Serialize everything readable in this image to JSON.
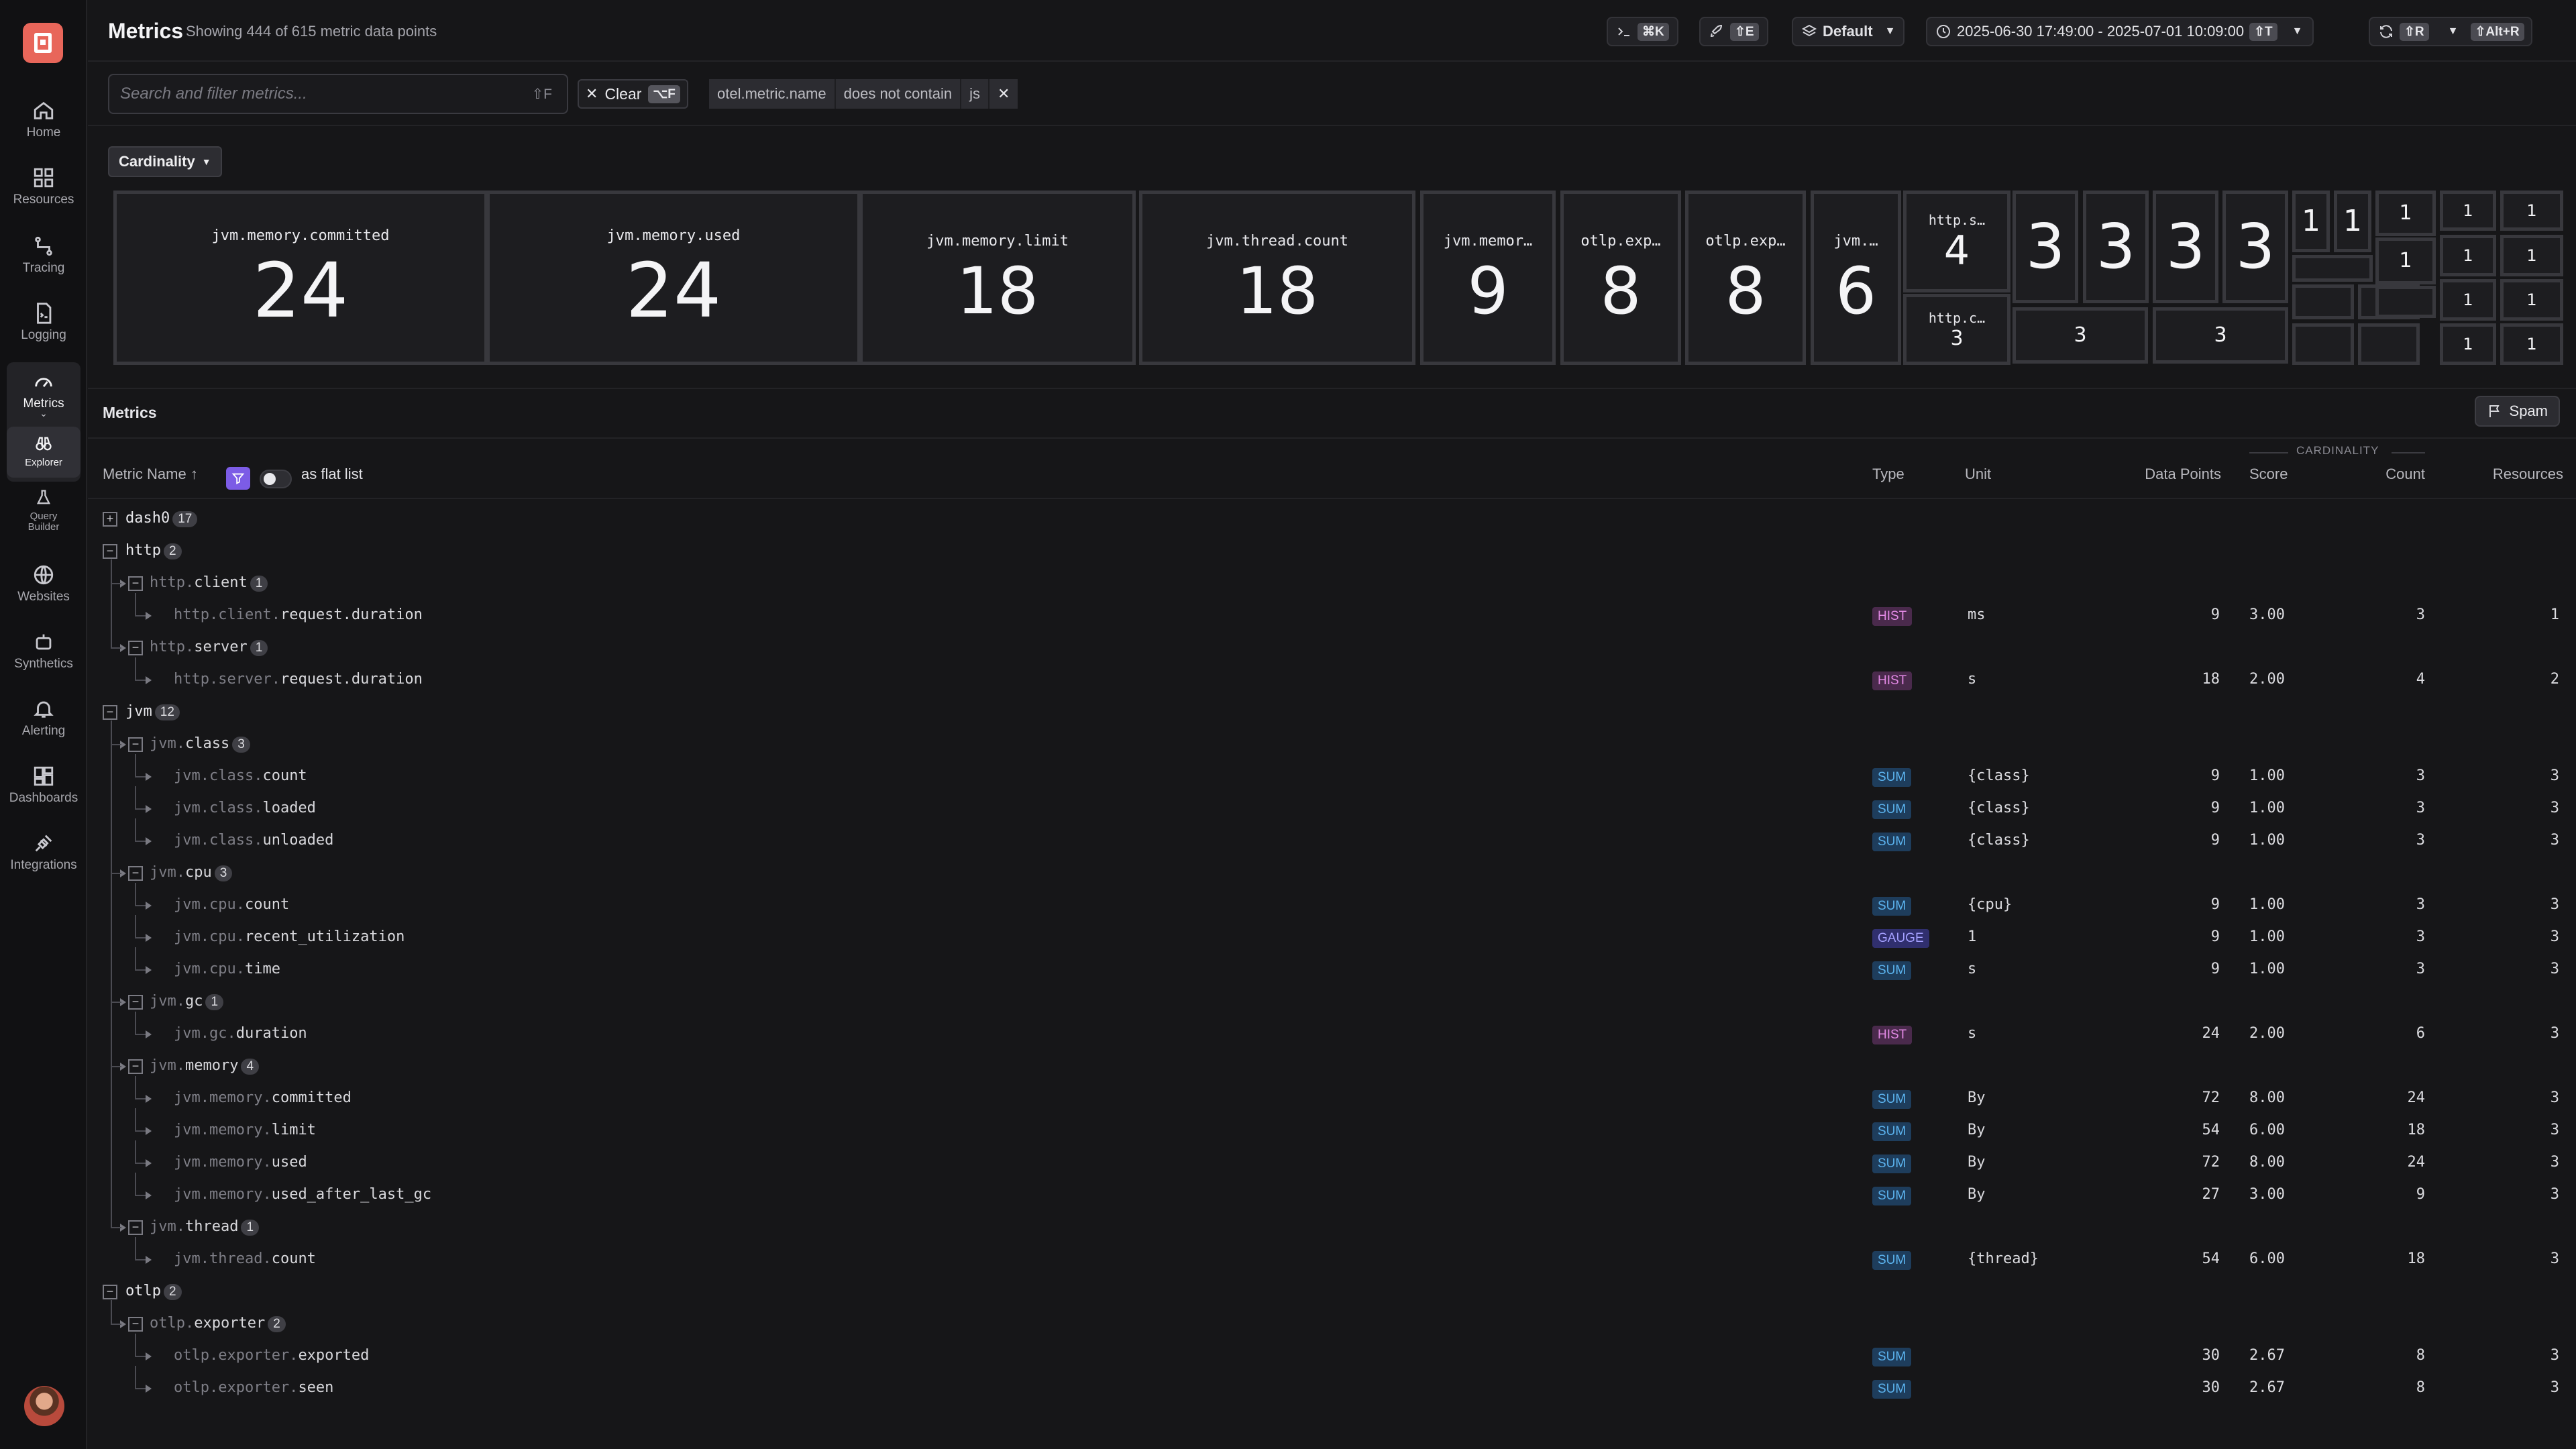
{
  "header": {
    "title": "Metrics",
    "subtitle": "Showing 444 of 615 metric data points",
    "command_kbd": "⌘K",
    "rocket_kbd": "⇧E",
    "dataset_label": "Default",
    "time_range": "2025-06-30 17:49:00 - 2025-07-01 10:09:00",
    "time_kbd": "⇧T",
    "refresh_kbd": "⇧R",
    "auto_kbd": "⇧Alt+R"
  },
  "sidebar": {
    "items": [
      {
        "label": "Home",
        "icon": "home-icon"
      },
      {
        "label": "Resources",
        "icon": "resources-icon"
      },
      {
        "label": "Tracing",
        "icon": "tracing-icon"
      },
      {
        "label": "Logging",
        "icon": "logging-icon"
      },
      {
        "label": "Metrics",
        "icon": "gauge-icon"
      },
      {
        "label": "Explorer",
        "icon": "binoculars-icon"
      },
      {
        "label": "Query Builder",
        "icon": "flask-icon"
      },
      {
        "label": "Websites",
        "icon": "globe-icon"
      },
      {
        "label": "Synthetics",
        "icon": "robot-icon"
      },
      {
        "label": "Alerting",
        "icon": "bell-icon"
      },
      {
        "label": "Dashboards",
        "icon": "dashboard-icon"
      },
      {
        "label": "Integrations",
        "icon": "plug-icon"
      }
    ]
  },
  "filter": {
    "search_placeholder": "Search and filter metrics...",
    "search_hint": "⇧F",
    "clear_label": "Clear",
    "clear_kbd": "⌥F",
    "chip_key": "otel.metric.name",
    "chip_op": "does not contain",
    "chip_value": "js"
  },
  "cardinality": {
    "dropdown_label": "Cardinality",
    "tiles": [
      {
        "name": "jvm.memory.committed",
        "value": "24"
      },
      {
        "name": "jvm.memory.used",
        "value": "24"
      },
      {
        "name": "jvm.memory.limit",
        "value": "18"
      },
      {
        "name": "jvm.thread.count",
        "value": "18"
      },
      {
        "name": "jvm.memor…",
        "value": "9"
      },
      {
        "name": "otlp.exp…",
        "value": "8"
      },
      {
        "name": "otlp.exp…",
        "value": "8"
      },
      {
        "name": "jvm.…",
        "value": "6"
      },
      {
        "name": "http.s…",
        "value": "4"
      },
      {
        "name": "http.c…",
        "value": "3"
      },
      {
        "name": "",
        "value": "3"
      },
      {
        "name": "",
        "value": "3"
      },
      {
        "name": "",
        "value": "3"
      },
      {
        "name": "",
        "value": "3"
      },
      {
        "name": "",
        "value": "3"
      },
      {
        "name": "",
        "value": "3"
      },
      {
        "name": "",
        "value": "1"
      },
      {
        "name": "",
        "value": "1"
      },
      {
        "name": "",
        "value": "1"
      },
      {
        "name": "",
        "value": "1"
      },
      {
        "name": "",
        "value": "1"
      },
      {
        "name": "",
        "value": "1"
      },
      {
        "name": "",
        "value": "1"
      },
      {
        "name": "",
        "value": "1"
      },
      {
        "name": "",
        "value": "1"
      },
      {
        "name": "",
        "value": "1"
      },
      {
        "name": "",
        "value": "1"
      },
      {
        "name": "",
        "value": "1"
      },
      {
        "name": "",
        "value": "1"
      },
      {
        "name": "",
        "value": ""
      },
      {
        "name": "",
        "value": ""
      },
      {
        "name": "",
        "value": ""
      },
      {
        "name": "",
        "value": ""
      },
      {
        "name": "",
        "value": ""
      }
    ]
  },
  "metrics": {
    "section_title": "Metrics",
    "spam_label": "Spam",
    "flat_list_label": "as flat list",
    "cardinality_group": "CARDINALITY",
    "columns": {
      "name": "Metric Name",
      "type": "Type",
      "unit": "Unit",
      "data_points": "Data Points",
      "score": "Score",
      "count": "Count",
      "resources": "Resources"
    },
    "rows": [
      {
        "prefix": "",
        "name": "dash0",
        "count": "17",
        "kind": "group",
        "expanded": false
      },
      {
        "prefix": "",
        "name": "http",
        "count": "2",
        "kind": "group",
        "expanded": true
      },
      {
        "prefix": "http.",
        "name": "client",
        "count": "1",
        "kind": "subgroup",
        "expanded": true
      },
      {
        "prefix": "http.client.",
        "name": "request.duration",
        "kind": "leaf",
        "type": "HIST",
        "unit": "ms",
        "dp": "9",
        "score": "3.00",
        "cnt": "3",
        "res": "1"
      },
      {
        "prefix": "http.",
        "name": "server",
        "count": "1",
        "kind": "subgroup",
        "expanded": true
      },
      {
        "prefix": "http.server.",
        "name": "request.duration",
        "kind": "leaf",
        "type": "HIST",
        "unit": "s",
        "dp": "18",
        "score": "2.00",
        "cnt": "4",
        "res": "2"
      },
      {
        "prefix": "",
        "name": "jvm",
        "count": "12",
        "kind": "group",
        "expanded": true
      },
      {
        "prefix": "jvm.",
        "name": "class",
        "count": "3",
        "kind": "subgroup",
        "expanded": true
      },
      {
        "prefix": "jvm.class.",
        "name": "count",
        "kind": "leaf",
        "type": "SUM",
        "unit": "{class}",
        "dp": "9",
        "score": "1.00",
        "cnt": "3",
        "res": "3"
      },
      {
        "prefix": "jvm.class.",
        "name": "loaded",
        "kind": "leaf",
        "type": "SUM",
        "unit": "{class}",
        "dp": "9",
        "score": "1.00",
        "cnt": "3",
        "res": "3"
      },
      {
        "prefix": "jvm.class.",
        "name": "unloaded",
        "kind": "leaf",
        "type": "SUM",
        "unit": "{class}",
        "dp": "9",
        "score": "1.00",
        "cnt": "3",
        "res": "3"
      },
      {
        "prefix": "jvm.",
        "name": "cpu",
        "count": "3",
        "kind": "subgroup",
        "expanded": true
      },
      {
        "prefix": "jvm.cpu.",
        "name": "count",
        "kind": "leaf",
        "type": "SUM",
        "unit": "{cpu}",
        "dp": "9",
        "score": "1.00",
        "cnt": "3",
        "res": "3"
      },
      {
        "prefix": "jvm.cpu.",
        "name": "recent_utilization",
        "kind": "leaf",
        "type": "GAUGE",
        "unit": "1",
        "dp": "9",
        "score": "1.00",
        "cnt": "3",
        "res": "3"
      },
      {
        "prefix": "jvm.cpu.",
        "name": "time",
        "kind": "leaf",
        "type": "SUM",
        "unit": "s",
        "dp": "9",
        "score": "1.00",
        "cnt": "3",
        "res": "3"
      },
      {
        "prefix": "jvm.",
        "name": "gc",
        "count": "1",
        "kind": "subgroup",
        "expanded": true
      },
      {
        "prefix": "jvm.gc.",
        "name": "duration",
        "kind": "leaf",
        "type": "HIST",
        "unit": "s",
        "dp": "24",
        "score": "2.00",
        "cnt": "6",
        "res": "3"
      },
      {
        "prefix": "jvm.",
        "name": "memory",
        "count": "4",
        "kind": "subgroup",
        "expanded": true
      },
      {
        "prefix": "jvm.memory.",
        "name": "committed",
        "kind": "leaf",
        "type": "SUM",
        "unit": "By",
        "dp": "72",
        "score": "8.00",
        "cnt": "24",
        "res": "3"
      },
      {
        "prefix": "jvm.memory.",
        "name": "limit",
        "kind": "leaf",
        "type": "SUM",
        "unit": "By",
        "dp": "54",
        "score": "6.00",
        "cnt": "18",
        "res": "3"
      },
      {
        "prefix": "jvm.memory.",
        "name": "used",
        "kind": "leaf",
        "type": "SUM",
        "unit": "By",
        "dp": "72",
        "score": "8.00",
        "cnt": "24",
        "res": "3"
      },
      {
        "prefix": "jvm.memory.",
        "name": "used_after_last_gc",
        "kind": "leaf",
        "type": "SUM",
        "unit": "By",
        "dp": "27",
        "score": "3.00",
        "cnt": "9",
        "res": "3"
      },
      {
        "prefix": "jvm.",
        "name": "thread",
        "count": "1",
        "kind": "subgroup",
        "expanded": true
      },
      {
        "prefix": "jvm.thread.",
        "name": "count",
        "kind": "leaf",
        "type": "SUM",
        "unit": "{thread}",
        "dp": "54",
        "score": "6.00",
        "cnt": "18",
        "res": "3"
      },
      {
        "prefix": "",
        "name": "otlp",
        "count": "2",
        "kind": "group",
        "expanded": true
      },
      {
        "prefix": "otlp.",
        "name": "exporter",
        "count": "2",
        "kind": "subgroup",
        "expanded": true
      },
      {
        "prefix": "otlp.exporter.",
        "name": "exported",
        "kind": "leaf",
        "type": "SUM",
        "unit": "",
        "dp": "30",
        "score": "2.67",
        "cnt": "8",
        "res": "3"
      },
      {
        "prefix": "otlp.exporter.",
        "name": "seen",
        "kind": "leaf",
        "type": "SUM",
        "unit": "",
        "dp": "30",
        "score": "2.67",
        "cnt": "8",
        "res": "3"
      }
    ]
  },
  "colors": {
    "HIST": {
      "bg": "#4a2a4c",
      "fg": "#e48ae6"
    },
    "SUM": {
      "bg": "#1e3d5c",
      "fg": "#5cb4f0"
    },
    "GAUGE": {
      "bg": "#302f6e",
      "fg": "#a4a0ff"
    },
    "accent": "#7c5ce6",
    "brand": "#e8665a"
  }
}
